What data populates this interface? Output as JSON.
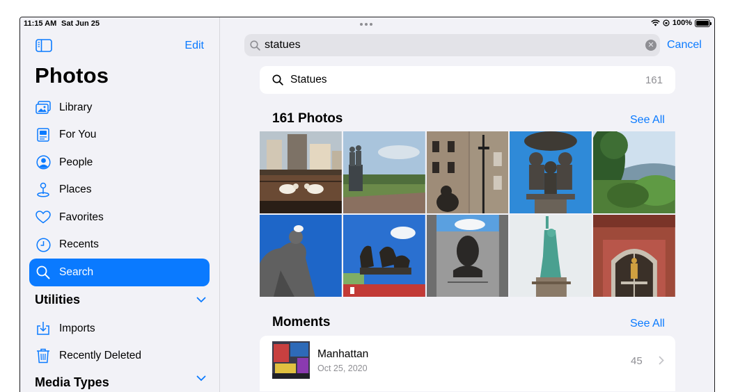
{
  "status": {
    "time": "11:15 AM",
    "date": "Sat Jun 25",
    "battery": "100%"
  },
  "sidebar": {
    "edit_label": "Edit",
    "title": "Photos",
    "items": [
      {
        "label": "Library",
        "icon": "library-icon"
      },
      {
        "label": "For You",
        "icon": "for-you-icon"
      },
      {
        "label": "People",
        "icon": "people-icon"
      },
      {
        "label": "Places",
        "icon": "places-icon"
      },
      {
        "label": "Favorites",
        "icon": "heart-icon"
      },
      {
        "label": "Recents",
        "icon": "clock-icon"
      },
      {
        "label": "Search",
        "icon": "search-icon",
        "active": true
      }
    ],
    "utilities_label": "Utilities",
    "utilities": [
      {
        "label": "Imports",
        "icon": "imports-icon"
      },
      {
        "label": "Recently Deleted",
        "icon": "trash-icon"
      }
    ],
    "media_types_label": "Media Types"
  },
  "search": {
    "query": "statues",
    "cancel_label": "Cancel",
    "suggestion": {
      "label": "Statues",
      "count": "161"
    }
  },
  "photos_section": {
    "title": "161 Photos",
    "see_all": "See All"
  },
  "moments_section": {
    "title": "Moments",
    "see_all": "See All",
    "item": {
      "title": "Manhattan",
      "date": "Oct 25, 2020",
      "count": "45"
    }
  },
  "colors": {
    "accent": "#0a7aff",
    "background": "#f2f2f7"
  }
}
